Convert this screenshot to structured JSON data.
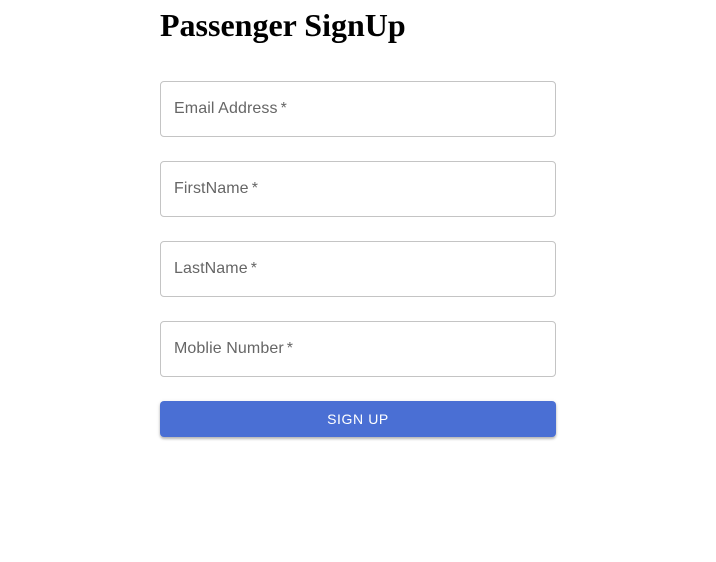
{
  "page": {
    "title": "Passenger SignUp"
  },
  "form": {
    "fields": [
      {
        "label": "Email Address",
        "required_mark": "*",
        "value": ""
      },
      {
        "label": "FirstName",
        "required_mark": "*",
        "value": ""
      },
      {
        "label": "LastName",
        "required_mark": "*",
        "value": ""
      },
      {
        "label": "Moblie Number",
        "required_mark": "*",
        "value": ""
      }
    ],
    "submit_label": "SIGN UP"
  },
  "colors": {
    "primary": "#4a6fd4",
    "field_border": "#c4c4c4",
    "label_text": "#666666"
  }
}
